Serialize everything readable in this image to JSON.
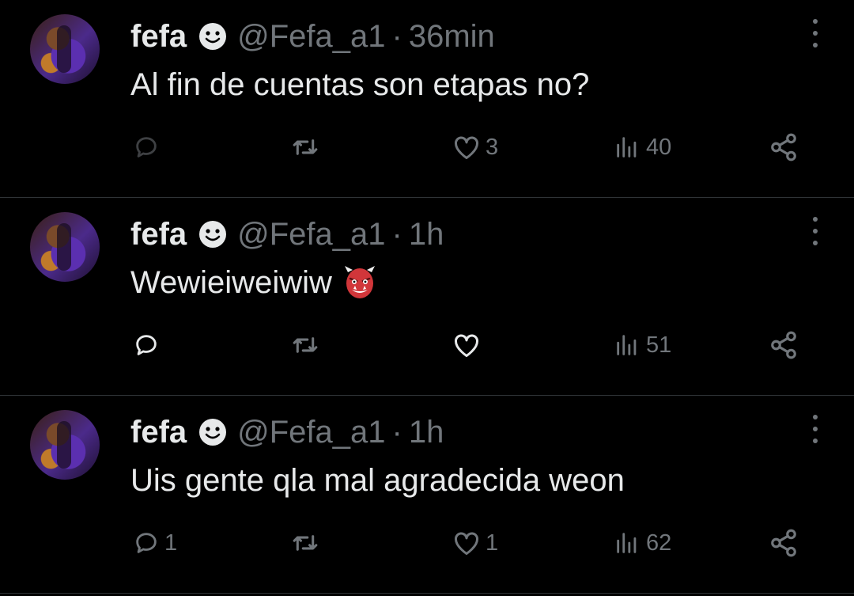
{
  "theme": {
    "background": "#000000",
    "text": "#e7e9ea",
    "muted": "#71767b",
    "divider": "#2f3336"
  },
  "tweets": [
    {
      "name": "fefa",
      "handle": "@Fefa_a1",
      "separator": "·",
      "time": "36min",
      "text": "Al fin de cuentas son etapas no?",
      "reply_count": "",
      "retweet_count": "",
      "like_count": "3",
      "view_count": "40",
      "emoji": ""
    },
    {
      "name": "fefa",
      "handle": "@Fefa_a1",
      "separator": "·",
      "time": "1h",
      "text": "Wewieiweiwiw",
      "reply_count": "",
      "retweet_count": "",
      "like_count": "",
      "view_count": "51",
      "emoji": "ogre-emoji"
    },
    {
      "name": "fefa",
      "handle": "@Fefa_a1",
      "separator": "·",
      "time": "1h",
      "text": "Uis gente qla mal agradecida weon",
      "reply_count": "1",
      "retweet_count": "",
      "like_count": "1",
      "view_count": "62",
      "emoji": ""
    }
  ],
  "icons": {
    "badge": "smiling-face-icon",
    "reply": "reply-icon",
    "retweet": "retweet-icon",
    "like": "heart-icon",
    "views": "views-icon",
    "share": "share-icon",
    "more": "more-options-icon"
  }
}
